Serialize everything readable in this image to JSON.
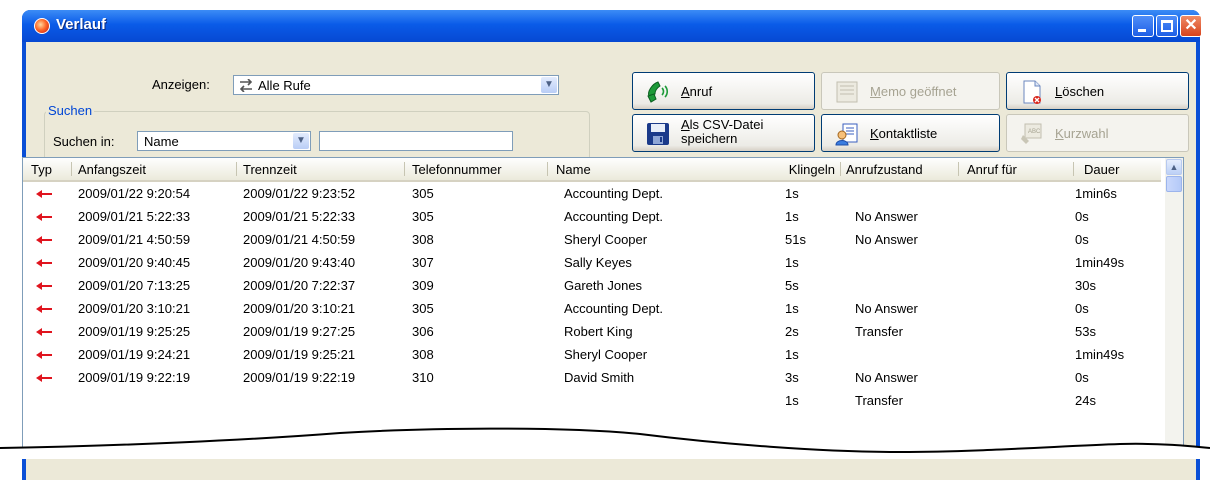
{
  "window": {
    "title": "Verlauf"
  },
  "filter": {
    "show_label": "Anzeigen:",
    "show_value": "Alle Rufe"
  },
  "search": {
    "group_label": "Suchen",
    "in_label": "Suchen in:",
    "field_value": "Name",
    "text_value": ""
  },
  "buttons": {
    "call": {
      "mnemonic": "A",
      "rest": "nruf"
    },
    "csv": {
      "mnemonic": "A",
      "line1_rest": "ls CSV-Datei",
      "line2": "speichern"
    },
    "memo": {
      "mnemonic": "M",
      "rest": "emo geöffnet"
    },
    "contacts": {
      "mnemonic": "K",
      "rest": "ontaktliste"
    },
    "delete": {
      "mnemonic": "L",
      "rest": "öschen"
    },
    "speeddial": {
      "mnemonic": "K",
      "rest": "urzwahl"
    }
  },
  "table": {
    "columns": [
      "Typ",
      "Anfangszeit",
      "Trennzeit",
      "Telefonnummer",
      "Name",
      "Klingeln",
      "Anrufzustand",
      "Anruf für",
      "Dauer"
    ],
    "rows": [
      {
        "start": "2009/01/22 9:20:54",
        "end": "2009/01/22 9:23:52",
        "number": "305",
        "name": "Accounting Dept.",
        "ring": "1s",
        "status": "",
        "for": "",
        "duration": "1min6s"
      },
      {
        "start": "2009/01/21 5:22:33",
        "end": "2009/01/21 5:22:33",
        "number": "305",
        "name": "Accounting Dept.",
        "ring": "1s",
        "status": "No Answer",
        "for": "",
        "duration": "0s"
      },
      {
        "start": "2009/01/21 4:50:59",
        "end": "2009/01/21 4:50:59",
        "number": "308",
        "name": "Sheryl Cooper",
        "ring": "51s",
        "status": "No Answer",
        "for": "",
        "duration": "0s"
      },
      {
        "start": "2009/01/20 9:40:45",
        "end": "2009/01/20 9:43:40",
        "number": "307",
        "name": "Sally Keyes",
        "ring": "1s",
        "status": "",
        "for": "",
        "duration": "1min49s"
      },
      {
        "start": "2009/01/20 7:13:25",
        "end": "2009/01/20 7:22:37",
        "number": "309",
        "name": "Gareth Jones",
        "ring": "5s",
        "status": "",
        "for": "",
        "duration": "30s"
      },
      {
        "start": "2009/01/20 3:10:21",
        "end": "2009/01/20 3:10:21",
        "number": "305",
        "name": "Accounting Dept.",
        "ring": "1s",
        "status": "No Answer",
        "for": "",
        "duration": "0s"
      },
      {
        "start": "2009/01/19 9:25:25",
        "end": "2009/01/19 9:27:25",
        "number": "306",
        "name": "Robert King",
        "ring": "2s",
        "status": "Transfer",
        "for": "",
        "duration": "53s"
      },
      {
        "start": "2009/01/19 9:24:21",
        "end": "2009/01/19 9:25:21",
        "number": "308",
        "name": "Sheryl Cooper",
        "ring": "1s",
        "status": "",
        "for": "",
        "duration": "1min49s"
      },
      {
        "start": "2009/01/19 9:22:19",
        "end": "2009/01/19 9:22:19",
        "number": "310",
        "name": "David Smith",
        "ring": "3s",
        "status": "No Answer",
        "for": "",
        "duration": "0s"
      },
      {
        "start": "",
        "end": "",
        "number": "",
        "name": "",
        "ring": "1s",
        "status": "Transfer",
        "for": "",
        "duration": "24s"
      }
    ]
  },
  "colors": {
    "accent": "#0a4fd6",
    "incoming_arrow": "#e0141e",
    "group_label": "#0046d5"
  },
  "icons": {
    "title": "app-icon",
    "row_type": "incoming-call-arrow-icon",
    "call": "phone-handset-icon",
    "csv": "save-disk-icon",
    "memo": "memo-icon",
    "contacts": "contact-list-icon",
    "delete": "delete-document-icon",
    "speeddial": "speed-dial-icon"
  }
}
